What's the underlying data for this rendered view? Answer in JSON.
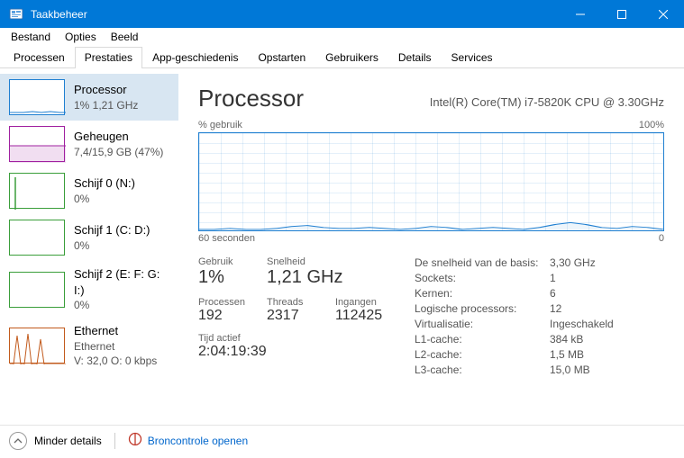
{
  "window": {
    "title": "Taakbeheer"
  },
  "menubar": [
    "Bestand",
    "Opties",
    "Beeld"
  ],
  "tabs": [
    {
      "label": "Processen"
    },
    {
      "label": "Prestaties",
      "selected": true
    },
    {
      "label": "App-geschiedenis"
    },
    {
      "label": "Opstarten"
    },
    {
      "label": "Gebruikers"
    },
    {
      "label": "Details"
    },
    {
      "label": "Services"
    }
  ],
  "sidebar": [
    {
      "name": "Processor",
      "val": "1% 1,21 GHz",
      "color": "#1f7fd1",
      "selected": true,
      "shape": "cpu"
    },
    {
      "name": "Geheugen",
      "val": "7,4/15,9 GB (47%)",
      "color": "#a020a0",
      "shape": "mem"
    },
    {
      "name": "Schijf 0 (N:)",
      "val": "0%",
      "color": "#3a9e3a",
      "shape": "disk0"
    },
    {
      "name": "Schijf 1 (C: D:)",
      "val": "0%",
      "color": "#3a9e3a",
      "shape": "disk1"
    },
    {
      "name": "Schijf 2 (E: F: G: I:)",
      "val": "0%",
      "color": "#3a9e3a",
      "shape": "disk2"
    },
    {
      "name": "Ethernet",
      "val2a": "Ethernet",
      "val": "V: 32,0 O: 0 kbps",
      "color": "#c25a1c",
      "shape": "eth"
    }
  ],
  "main": {
    "title": "Processor",
    "subtitle": "Intel(R) Core(TM) i7-5820K CPU @ 3.30GHz",
    "chart_top_left": "% gebruik",
    "chart_top_right": "100%",
    "chart_bottom_left": "60 seconden",
    "chart_bottom_right": "0",
    "left_stats": {
      "row1_labels": [
        "Gebruik",
        "Snelheid"
      ],
      "row1_vals": [
        "1%",
        "1,21 GHz"
      ],
      "row2_labels": [
        "Processen",
        "Threads",
        "Ingangen"
      ],
      "row2_vals": [
        "192",
        "2317",
        "112425"
      ],
      "uptime_label": "Tijd actief",
      "uptime_val": "2:04:19:39"
    },
    "right_stats": [
      {
        "lbl": "De snelheid van de basis:",
        "val": "3,30 GHz"
      },
      {
        "lbl": "Sockets:",
        "val": "1"
      },
      {
        "lbl": "Kernen:",
        "val": "6"
      },
      {
        "lbl": "Logische processors:",
        "val": "12"
      },
      {
        "lbl": "Virtualisatie:",
        "val": "Ingeschakeld"
      },
      {
        "lbl": "L1-cache:",
        "val": "384 kB"
      },
      {
        "lbl": "L2-cache:",
        "val": "1,5 MB"
      },
      {
        "lbl": "L3-cache:",
        "val": "15,0 MB"
      }
    ]
  },
  "footer": {
    "fewer": "Minder details",
    "resmon": "Broncontrole openen"
  },
  "chart_data": {
    "type": "line",
    "title": "% gebruik",
    "xlabel": "60 seconden",
    "ylabel": "%",
    "ylim": [
      0,
      100
    ],
    "xlim": [
      60,
      0
    ],
    "x_seconds_ago": [
      60,
      58,
      56,
      54,
      52,
      50,
      48,
      46,
      44,
      42,
      40,
      38,
      36,
      34,
      32,
      30,
      28,
      26,
      24,
      22,
      20,
      18,
      16,
      14,
      12,
      10,
      8,
      6,
      4,
      2,
      0
    ],
    "values_pct": [
      1,
      1,
      2,
      1,
      1,
      2,
      4,
      5,
      3,
      2,
      2,
      3,
      2,
      1,
      2,
      4,
      3,
      1,
      2,
      3,
      2,
      1,
      3,
      6,
      8,
      6,
      3,
      2,
      4,
      3,
      1
    ]
  }
}
